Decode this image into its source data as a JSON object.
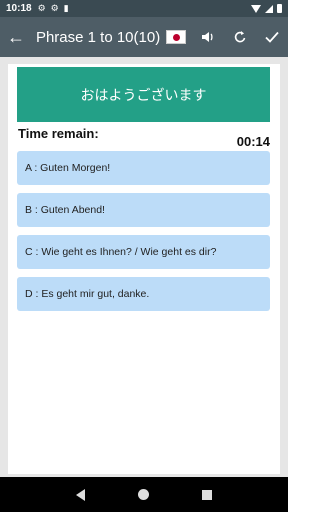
{
  "statusbar": {
    "time": "10:18",
    "icons": [
      "gear-icon",
      "gear-icon",
      "sim-icon"
    ]
  },
  "appbar": {
    "back_icon": "arrow-left-icon",
    "title": "Phrase 1 to 10(10)",
    "flag": "japan-flag-icon",
    "actions": [
      "volume-icon",
      "replay-icon",
      "check-icon"
    ]
  },
  "quiz": {
    "question": "おはようございます",
    "timer_label": "Time remain:",
    "timer_value": "00:14",
    "answers": [
      {
        "label": "A : Guten Morgen!"
      },
      {
        "label": "B : Guten Abend!"
      },
      {
        "label": "C : Wie geht es Ihnen? / Wie geht es dir?"
      },
      {
        "label": "D : Es geht mir gut, danke."
      }
    ]
  },
  "colors": {
    "appbar": "#4e5d66",
    "statusbar": "#3a4a52",
    "question_bg": "#23a087",
    "answer_bg": "#bcdcf8"
  }
}
